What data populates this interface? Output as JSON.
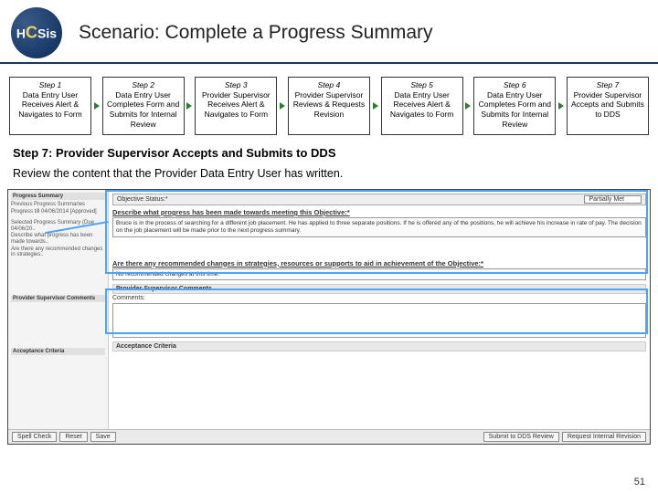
{
  "header": {
    "logo_pre": "H",
    "logo_c": "C",
    "logo_post": "Sis",
    "title": "Scenario: Complete a Progress Summary"
  },
  "steps": [
    {
      "num": "Step 1",
      "text": "Data Entry User Receives Alert & Navigates to Form"
    },
    {
      "num": "Step 2",
      "text": "Data Entry User Completes Form and Submits for Internal Review"
    },
    {
      "num": "Step 3",
      "text": "Provider Supervisor Receives Alert & Navigates to Form"
    },
    {
      "num": "Step 4",
      "text": "Provider Supervisor Reviews & Requests Revision"
    },
    {
      "num": "Step 5",
      "text": "Data Entry User Receives Alert & Navigates to Form"
    },
    {
      "num": "Step 6",
      "text": "Data Entry User Completes Form and Submits for Internal Review"
    },
    {
      "num": "Step 7",
      "text": "Provider Supervisor Accepts and Submits to DDS"
    }
  ],
  "section": {
    "heading": "Step 7: Provider Supervisor Accepts and Submits to DDS",
    "body": "Review the content that the Provider Data Entry User has written."
  },
  "form": {
    "side": {
      "h1": "Progress Summary",
      "l1": "Previous Progress Summaries",
      "l2": "Progress till 04/06/2014 [Approved]",
      "l3": "Selected Progress Summary (Due 04/06/20..",
      "l4": "Describe what progress has been made towards..",
      "l5": "Are there any recommended changes in strategies..",
      "h2": "Provider Supervisor Comments",
      "h3": "Acceptance Criteria"
    },
    "status_label": "Objective Status:*",
    "status_value": "Partially Met",
    "q1_label": "Describe what progress has been made towards meeting this Objective:*",
    "q1_text": "Bruce is in the process of searching for a different job placement. He has applied to three separate positions. If he is offered any of the positions, he will achieve his increase in rate of pay. The decision on the job placement will be made prior to the next progress summary.",
    "q2_label": "Are there any recommended changes in strategies, resources or supports to aid in achievement of the Objective:*",
    "q2_text": "No recommended changes at this time.",
    "comments_label": "Comments:",
    "buttons": {
      "spell": "Spell Check",
      "reset": "Reset",
      "save": "Save",
      "submit_dds": "Submit to DDS Review",
      "request_rev": "Request Internal Revision"
    }
  },
  "page_number": "51"
}
